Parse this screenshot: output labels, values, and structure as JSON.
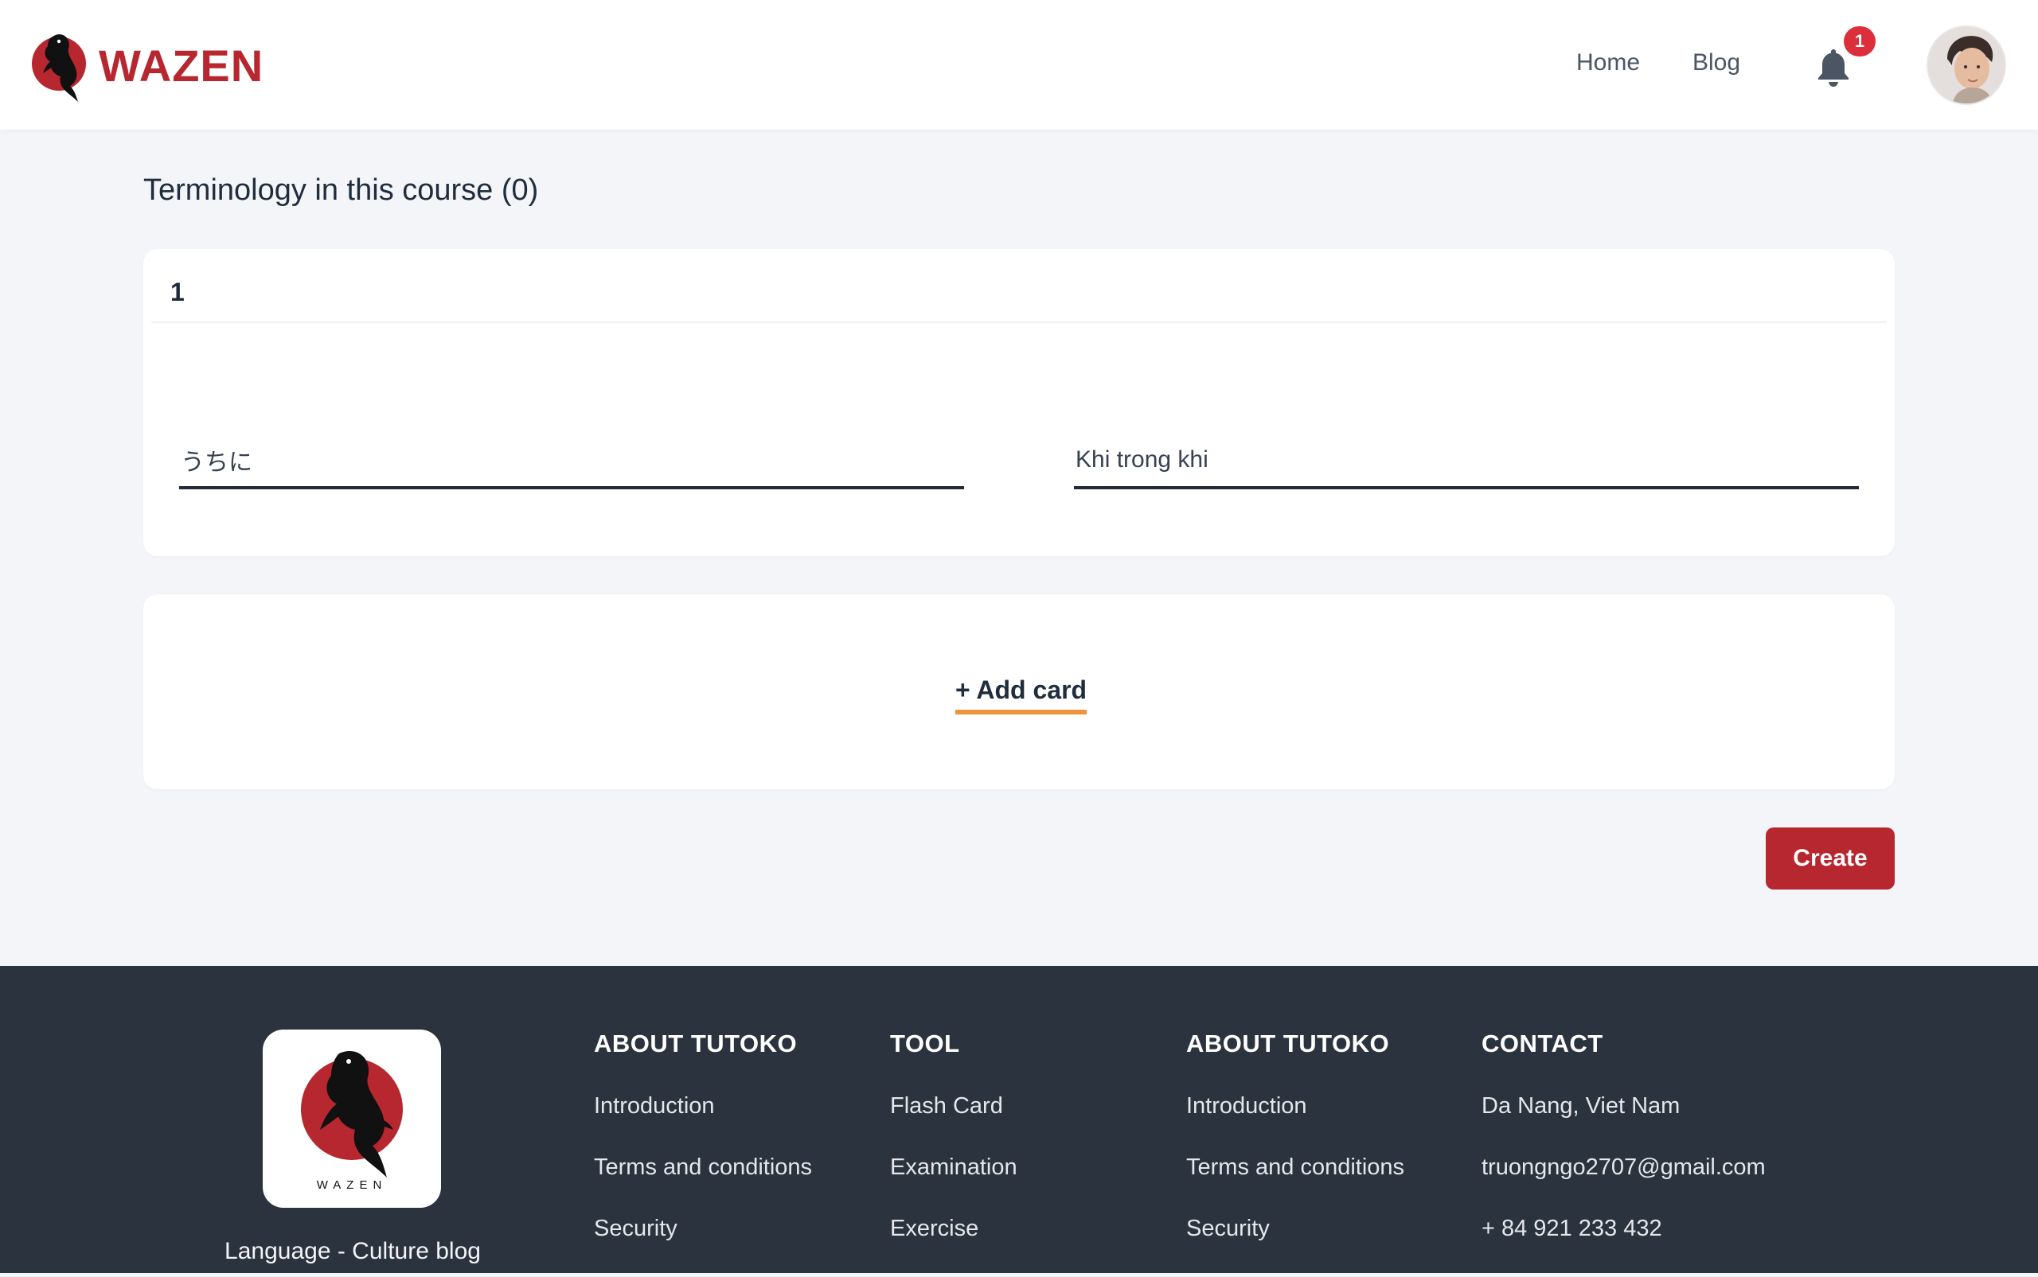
{
  "header": {
    "brand_name": "WAZEN",
    "nav": {
      "home": "Home",
      "blog": "Blog"
    },
    "notification_count": "1"
  },
  "main": {
    "section_title": "Terminology in this course (0)",
    "terms": [
      {
        "index": "1",
        "term_value": "うちに",
        "definition_value": "Khi trong khi"
      }
    ],
    "add_card_label": "+ Add card",
    "create_label": "Create"
  },
  "footer": {
    "tagline": "Language - Culture blog",
    "columns": [
      {
        "title": "ABOUT TUTOKO",
        "links": [
          "Introduction",
          "Terms and conditions",
          "Security"
        ]
      },
      {
        "title": "TOOL",
        "links": [
          "Flash Card",
          "Examination",
          "Exercise"
        ]
      },
      {
        "title": "ABOUT TUTOKO",
        "links": [
          "Introduction",
          "Terms and conditions",
          "Security"
        ]
      }
    ],
    "contact": {
      "title": "CONTACT",
      "address": "Da Nang, Viet Nam",
      "email": "truongngo2707@gmail.com",
      "phone": "+ 84 921 233 432"
    }
  },
  "colors": {
    "brand_red": "#b7272f",
    "accent_orange": "#f0923a",
    "footer_bg": "#2b333f",
    "page_bg": "#f4f5f9"
  }
}
